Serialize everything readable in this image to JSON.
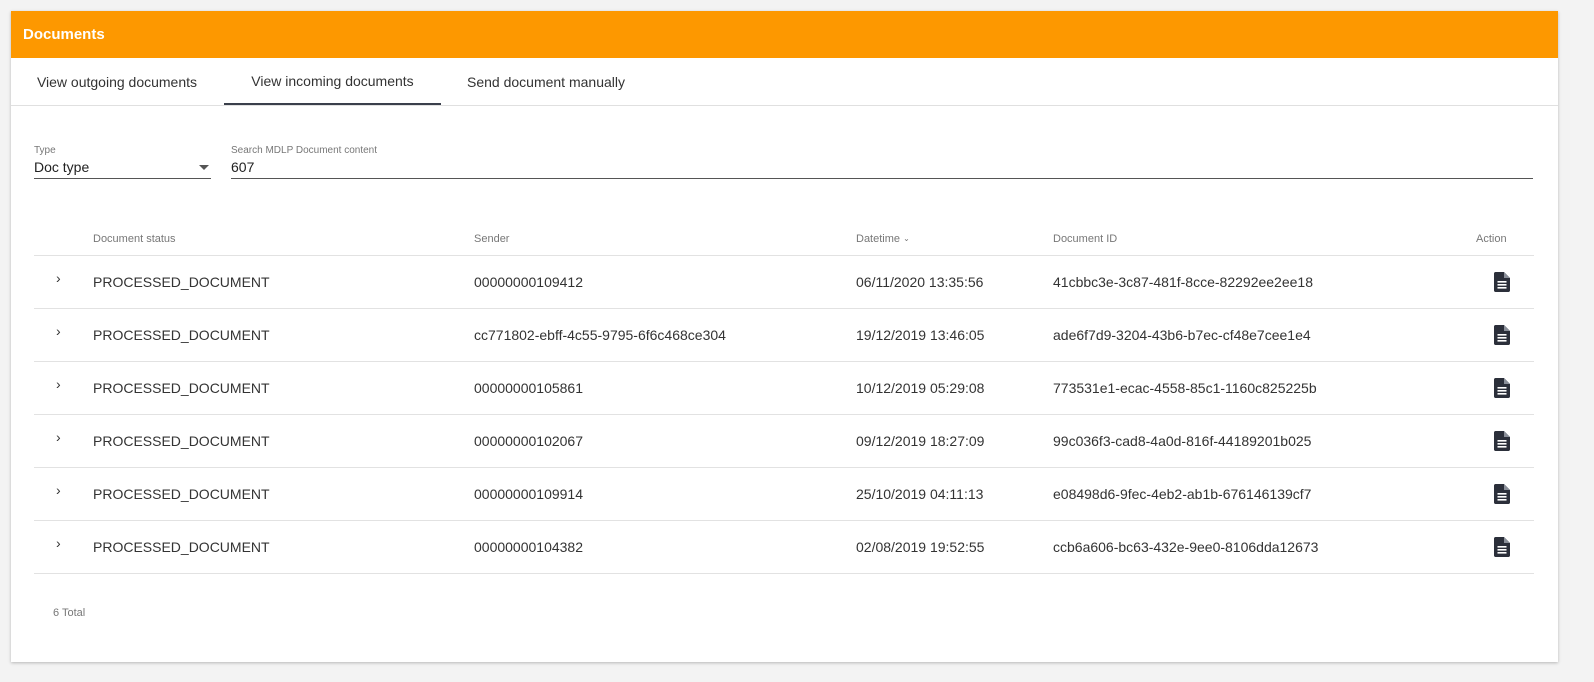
{
  "header": {
    "title": "Documents",
    "accent": "#fd9800"
  },
  "tabs": [
    {
      "label": "View outgoing documents",
      "active": false
    },
    {
      "label": "View incoming documents",
      "active": true
    },
    {
      "label": "Send document manually",
      "active": false
    }
  ],
  "filters": {
    "type": {
      "label": "Type",
      "value": "Doc type"
    },
    "search": {
      "label": "Search MDLP Document content",
      "value": "607"
    }
  },
  "table": {
    "columns": {
      "status": "Document status",
      "sender": "Sender",
      "datetime": "Datetime",
      "docid": "Document ID",
      "action": "Action"
    },
    "sort_indicator": "ˇ",
    "rows": [
      {
        "status": "PROCESSED_DOCUMENT",
        "sender": "00000000109412",
        "datetime": "06/11/2020 13:35:56",
        "docid": "41cbbc3e-3c87-481f-8cce-82292ee2ee18"
      },
      {
        "status": "PROCESSED_DOCUMENT",
        "sender": "cc771802-ebff-4c55-9795-6f6c468ce304",
        "datetime": "19/12/2019 13:46:05",
        "docid": "ade6f7d9-3204-43b6-b7ec-cf48e7cee1e4"
      },
      {
        "status": "PROCESSED_DOCUMENT",
        "sender": "00000000105861",
        "datetime": "10/12/2019 05:29:08",
        "docid": "773531e1-ecac-4558-85c1-1160c825225b"
      },
      {
        "status": "PROCESSED_DOCUMENT",
        "sender": "00000000102067",
        "datetime": "09/12/2019 18:27:09",
        "docid": "99c036f3-cad8-4a0d-816f-44189201b025"
      },
      {
        "status": "PROCESSED_DOCUMENT",
        "sender": "00000000109914",
        "datetime": "25/10/2019 04:11:13",
        "docid": "e08498d6-9fec-4eb2-ab1b-676146139cf7"
      },
      {
        "status": "PROCESSED_DOCUMENT",
        "sender": "00000000104382",
        "datetime": "02/08/2019 19:52:55",
        "docid": "ccb6a606-bc63-432e-9ee0-8106dda12673"
      }
    ],
    "expand_glyph": "›",
    "action_icon": "document-icon"
  },
  "footer": {
    "total": "6 Total"
  }
}
